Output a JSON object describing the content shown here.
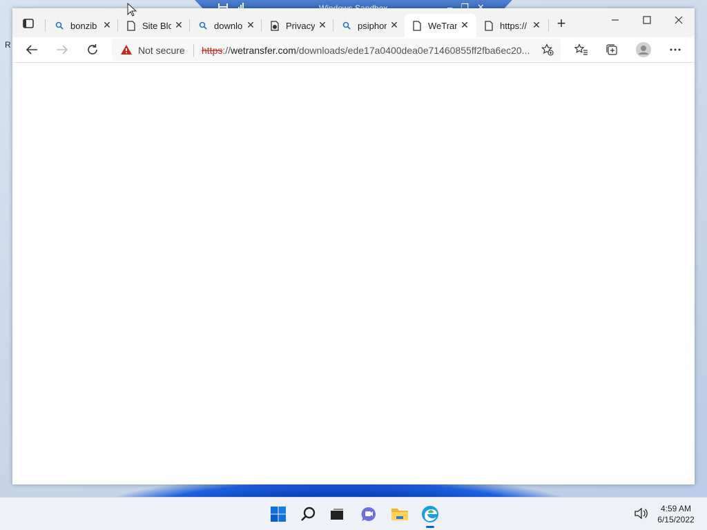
{
  "sandbox": {
    "title": "Windows Sandbox"
  },
  "desktop": {
    "edge_glyph": "R"
  },
  "browser": {
    "tabs": [
      {
        "title": "bonzib",
        "icon": "search-icon",
        "active": false
      },
      {
        "title": "Site Blc",
        "icon": "page-icon",
        "active": false
      },
      {
        "title": "downlo",
        "icon": "search-icon",
        "active": false
      },
      {
        "title": "Privacy",
        "icon": "privacy-page-icon",
        "active": false
      },
      {
        "title": "psiphon",
        "icon": "search-icon",
        "active": false
      },
      {
        "title": "WeTran",
        "icon": "page-icon",
        "active": true
      },
      {
        "title": "https://",
        "icon": "page-icon",
        "active": false
      }
    ],
    "address": {
      "security_label": "Not secure",
      "url_protocol": "https",
      "url_sep": "://",
      "url_host": "wetransfer.com",
      "url_path": "/downloads/ede17a0400dea0e71460855ff2fba6ec20..."
    }
  },
  "taskbar": {
    "time": "4:59 AM",
    "date": "6/15/2022"
  },
  "colors": {
    "accent": "#0067c0",
    "warning": "#c42b1c"
  }
}
